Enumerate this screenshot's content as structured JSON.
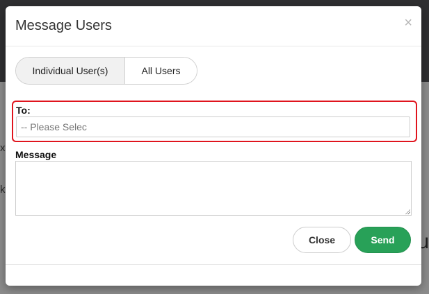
{
  "modal": {
    "title": "Message Users",
    "close_glyph": "×"
  },
  "recipient_toggle": {
    "options": [
      {
        "label": "Individual User(s)",
        "active": true
      },
      {
        "label": "All Users",
        "active": false
      }
    ]
  },
  "form": {
    "to_label": "To:",
    "to_placeholder": "-- Please Selec",
    "message_label": "Message",
    "message_value": ""
  },
  "footer": {
    "close_label": "Close",
    "send_label": "Send"
  },
  "colors": {
    "send": "#28a158",
    "highlight": "#e0141d"
  },
  "background": {
    "glyph_a": "x",
    "glyph_b": "k",
    "glyph_c": "u"
  }
}
